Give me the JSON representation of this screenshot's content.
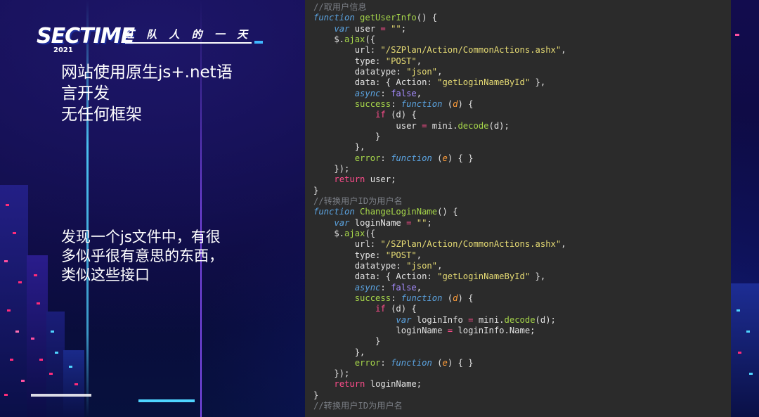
{
  "logo": {
    "main_text": "SECTIME",
    "year": "2021",
    "slogan": "红 队 人 的 一 天"
  },
  "notes": {
    "note1_lines": [
      "网站使用原生js+.net语",
      "言开发",
      "无任何框架"
    ],
    "note2_lines": [
      "发现一个js文件中，有很",
      "多似乎很有意思的东西，",
      "类似这些接口"
    ]
  },
  "code": {
    "lines": [
      [
        [
          "cm",
          "//取用户信息"
        ]
      ],
      [
        [
          "kw",
          "function"
        ],
        [
          "pn",
          " "
        ],
        [
          "fn",
          "getUserInfo"
        ],
        [
          "pn",
          "() {"
        ]
      ],
      [
        [
          "pn",
          "    "
        ],
        [
          "kw",
          "var"
        ],
        [
          "id",
          " user "
        ],
        [
          "op",
          "="
        ],
        [
          "st",
          " \"\""
        ],
        [
          "pn",
          ";"
        ]
      ],
      [
        [
          "pn",
          "    $."
        ],
        [
          "meth",
          "ajax"
        ],
        [
          "pn",
          "({"
        ]
      ],
      [
        [
          "pn",
          "        url: "
        ],
        [
          "st",
          "\"/SZPlan/Action/CommonActions.ashx\""
        ],
        [
          "pn",
          ","
        ]
      ],
      [
        [
          "pn",
          "        type: "
        ],
        [
          "st",
          "\"POST\""
        ],
        [
          "pn",
          ","
        ]
      ],
      [
        [
          "pn",
          "        datatype: "
        ],
        [
          "st",
          "\"json\""
        ],
        [
          "pn",
          ","
        ]
      ],
      [
        [
          "pn",
          "        data: { Action: "
        ],
        [
          "st",
          "\"getLoginNameById\""
        ],
        [
          "pn",
          " },"
        ]
      ],
      [
        [
          "pn",
          "        "
        ],
        [
          "kw",
          "async"
        ],
        [
          "pn",
          ": "
        ],
        [
          "bo",
          "false"
        ],
        [
          "pn",
          ","
        ]
      ],
      [
        [
          "pn",
          "        "
        ],
        [
          "fn",
          "success"
        ],
        [
          "pn",
          ": "
        ],
        [
          "kw",
          "function"
        ],
        [
          "pn",
          " ("
        ],
        [
          "prm",
          "d"
        ],
        [
          "pn",
          ") {"
        ]
      ],
      [
        [
          "pn",
          "            "
        ],
        [
          "op",
          "if"
        ],
        [
          "pn",
          " (d) {"
        ]
      ],
      [
        [
          "pn",
          "                user "
        ],
        [
          "op",
          "="
        ],
        [
          "pn",
          " mini."
        ],
        [
          "meth",
          "decode"
        ],
        [
          "pn",
          "(d);"
        ]
      ],
      [
        [
          "pn",
          "            }"
        ]
      ],
      [
        [
          "pn",
          "        },"
        ]
      ],
      [
        [
          "pn",
          "        "
        ],
        [
          "fn",
          "error"
        ],
        [
          "pn",
          ": "
        ],
        [
          "kw",
          "function"
        ],
        [
          "pn",
          " ("
        ],
        [
          "prm",
          "e"
        ],
        [
          "pn",
          ") { }"
        ]
      ],
      [
        [
          "pn",
          "    });"
        ]
      ],
      [
        [
          "pn",
          "    "
        ],
        [
          "op",
          "return"
        ],
        [
          "pn",
          " user;"
        ]
      ],
      [
        [
          "pn",
          "}"
        ]
      ],
      [
        [
          "cm",
          "//转换用户ID为用户名"
        ]
      ],
      [
        [
          "kw",
          "function"
        ],
        [
          "pn",
          " "
        ],
        [
          "fn",
          "ChangeLoginName"
        ],
        [
          "pn",
          "() {"
        ]
      ],
      [
        [
          "pn",
          "    "
        ],
        [
          "kw",
          "var"
        ],
        [
          "id",
          " loginName "
        ],
        [
          "op",
          "="
        ],
        [
          "st",
          " \"\""
        ],
        [
          "pn",
          ";"
        ]
      ],
      [
        [
          "pn",
          "    $."
        ],
        [
          "meth",
          "ajax"
        ],
        [
          "pn",
          "({"
        ]
      ],
      [
        [
          "pn",
          "        url: "
        ],
        [
          "st",
          "\"/SZPlan/Action/CommonActions.ashx\""
        ],
        [
          "pn",
          ","
        ]
      ],
      [
        [
          "pn",
          "        type: "
        ],
        [
          "st",
          "\"POST\""
        ],
        [
          "pn",
          ","
        ]
      ],
      [
        [
          "pn",
          "        datatype: "
        ],
        [
          "st",
          "\"json\""
        ],
        [
          "pn",
          ","
        ]
      ],
      [
        [
          "pn",
          "        data: { Action: "
        ],
        [
          "st",
          "\"getLoginNameById\""
        ],
        [
          "pn",
          " },"
        ]
      ],
      [
        [
          "pn",
          "        "
        ],
        [
          "kw",
          "async"
        ],
        [
          "pn",
          ": "
        ],
        [
          "bo",
          "false"
        ],
        [
          "pn",
          ","
        ]
      ],
      [
        [
          "pn",
          "        "
        ],
        [
          "fn",
          "success"
        ],
        [
          "pn",
          ": "
        ],
        [
          "kw",
          "function"
        ],
        [
          "pn",
          " ("
        ],
        [
          "prm",
          "d"
        ],
        [
          "pn",
          ") {"
        ]
      ],
      [
        [
          "pn",
          "            "
        ],
        [
          "op",
          "if"
        ],
        [
          "pn",
          " (d) {"
        ]
      ],
      [
        [
          "pn",
          "                "
        ],
        [
          "kw",
          "var"
        ],
        [
          "pn",
          " loginInfo "
        ],
        [
          "op",
          "="
        ],
        [
          "pn",
          " mini."
        ],
        [
          "meth",
          "decode"
        ],
        [
          "pn",
          "(d);"
        ]
      ],
      [
        [
          "pn",
          "                loginName "
        ],
        [
          "op",
          "="
        ],
        [
          "pn",
          " loginInfo.Name;"
        ]
      ],
      [
        [
          "pn",
          "            }"
        ]
      ],
      [
        [
          "pn",
          "        },"
        ]
      ],
      [
        [
          "pn",
          "        "
        ],
        [
          "fn",
          "error"
        ],
        [
          "pn",
          ": "
        ],
        [
          "kw",
          "function"
        ],
        [
          "pn",
          " ("
        ],
        [
          "prm",
          "e"
        ],
        [
          "pn",
          ") { }"
        ]
      ],
      [
        [
          "pn",
          "    });"
        ]
      ],
      [
        [
          "pn",
          "    "
        ],
        [
          "op",
          "return"
        ],
        [
          "pn",
          " loginName;"
        ]
      ],
      [
        [
          "pn",
          "}"
        ]
      ],
      [
        [
          "cm",
          "//转换用户ID为用户名"
        ]
      ]
    ]
  }
}
